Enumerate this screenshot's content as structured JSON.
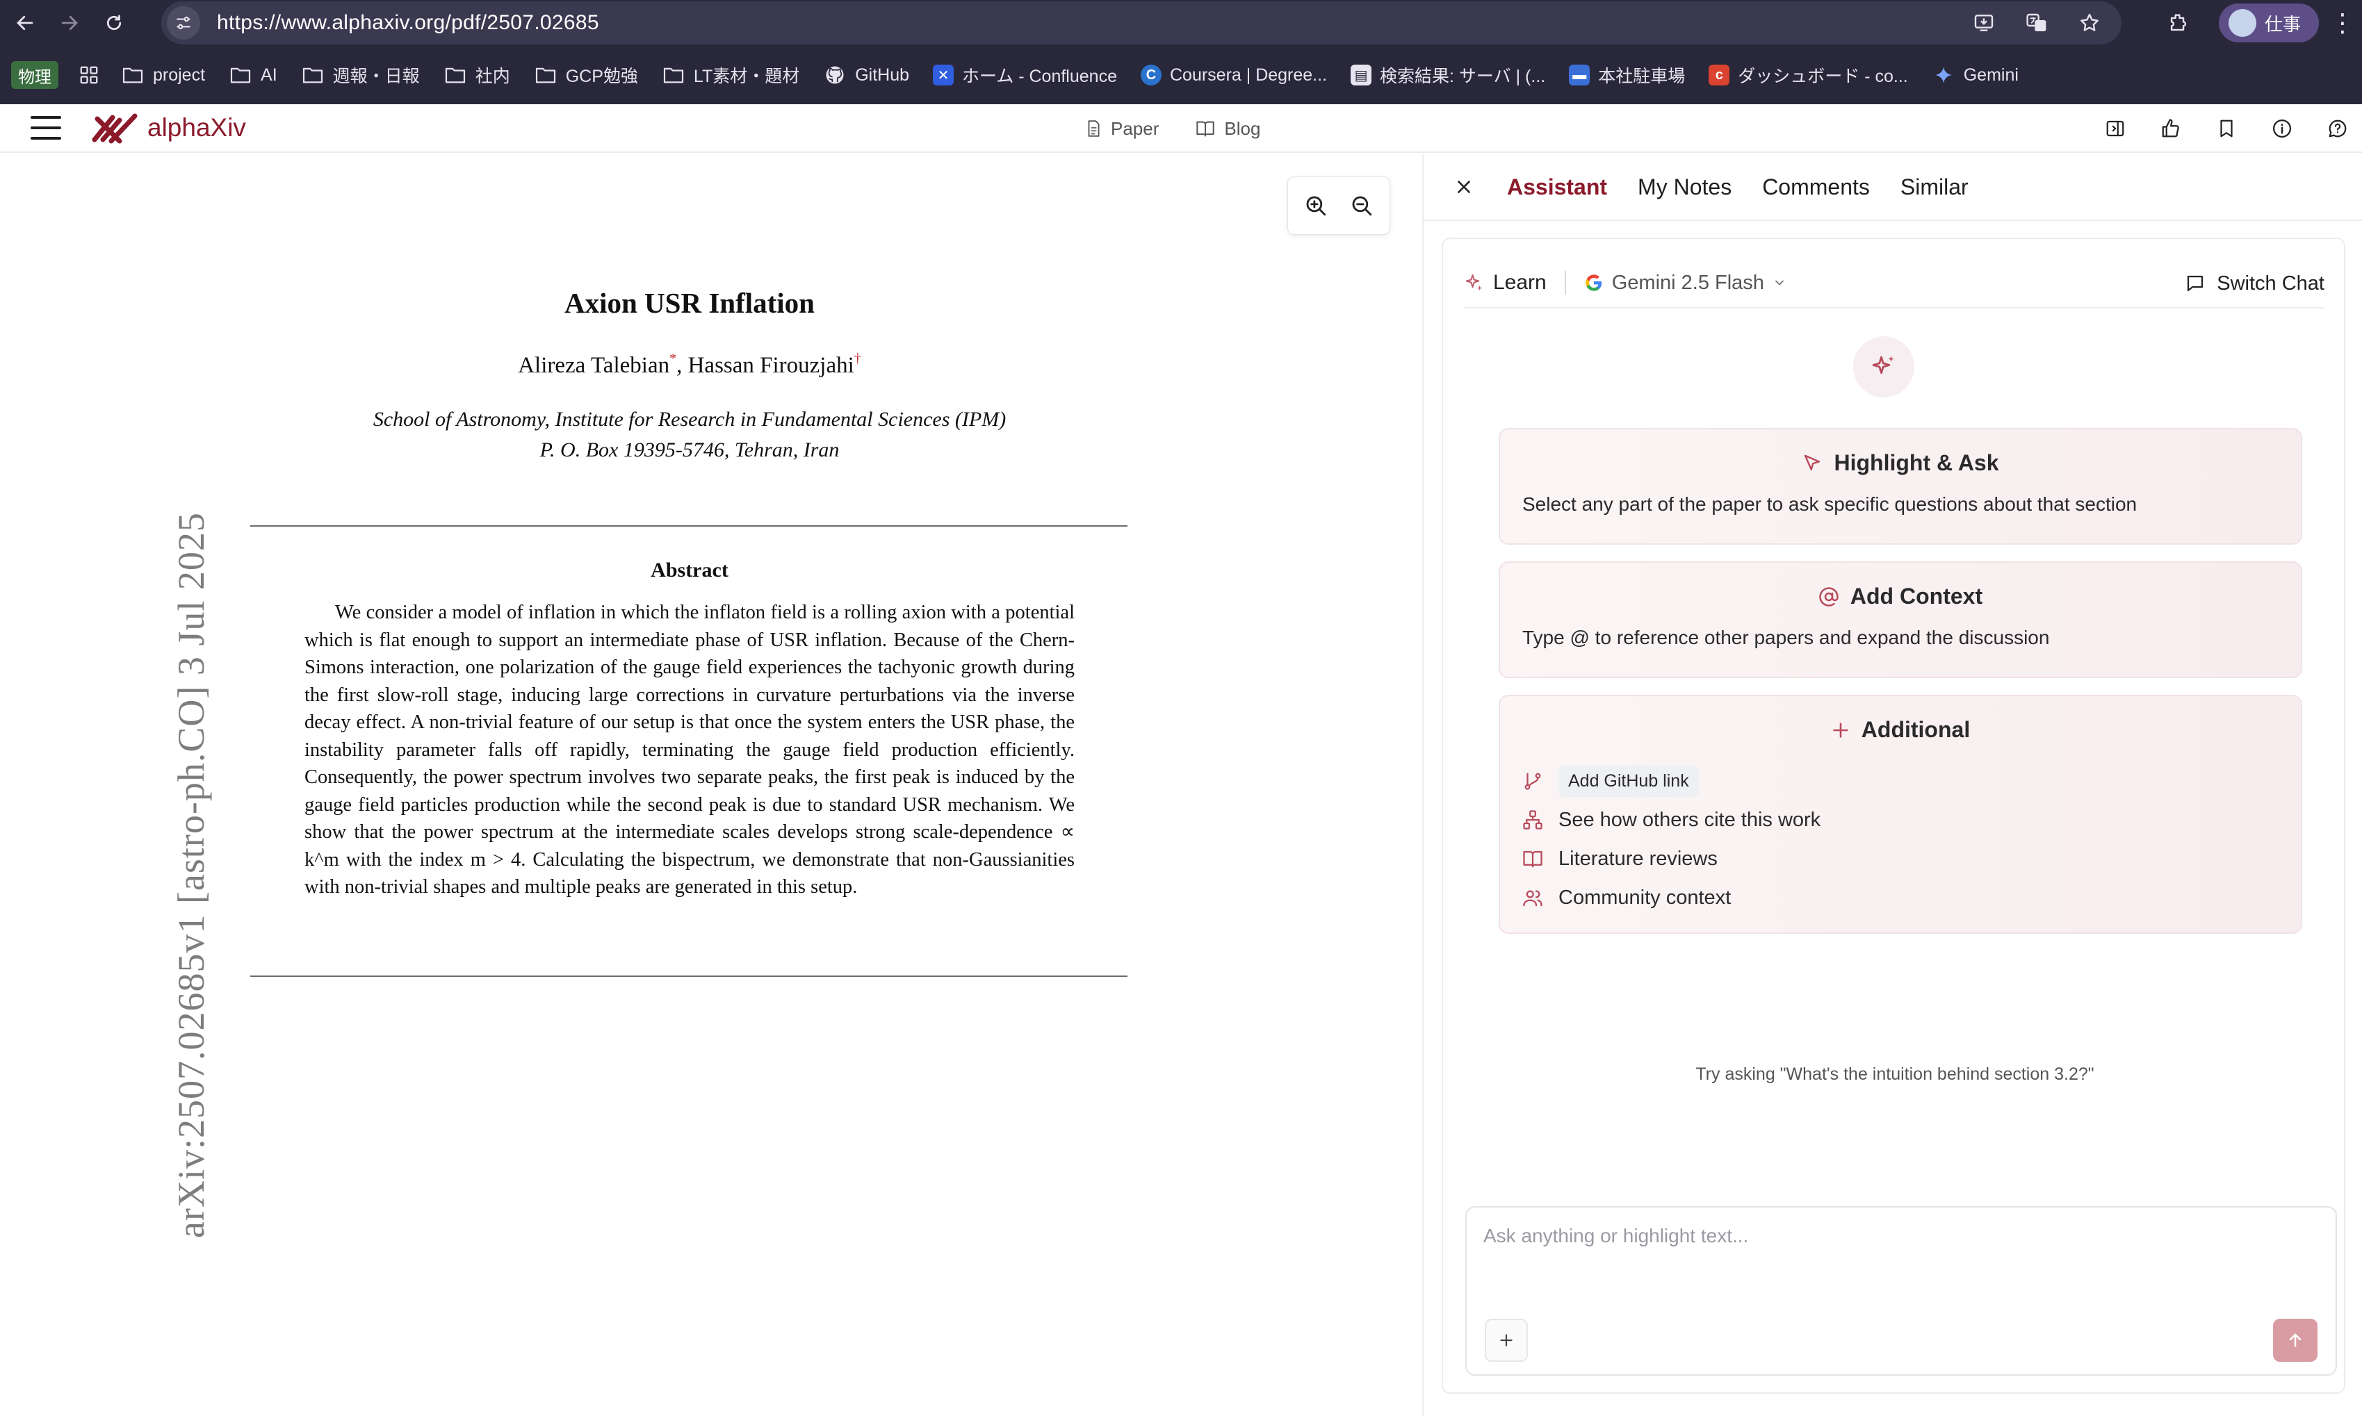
{
  "browser": {
    "url": "https://www.alphaxiv.org/pdf/2507.02685",
    "profile_label": "仕事",
    "bookmarks_first": "物理",
    "bookmarks": [
      {
        "label": "project",
        "icon": "folder-icon"
      },
      {
        "label": "AI",
        "icon": "folder-icon"
      },
      {
        "label": "週報・日報",
        "icon": "folder-icon"
      },
      {
        "label": "社内",
        "icon": "folder-icon"
      },
      {
        "label": "GCP勉強",
        "icon": "folder-icon"
      },
      {
        "label": "LT素材・題材",
        "icon": "folder-icon"
      },
      {
        "label": "GitHub",
        "icon": "github-icon"
      },
      {
        "label": "ホーム - Confluence",
        "icon": "confluence-icon"
      },
      {
        "label": "Coursera | Degree...",
        "icon": "coursera-icon"
      },
      {
        "label": "検索結果: サーバ | (...",
        "icon": "doc-icon"
      },
      {
        "label": "本社駐車場",
        "icon": "calendar-icon"
      },
      {
        "label": "ダッシュボード - co...",
        "icon": "c-icon"
      },
      {
        "label": "Gemini",
        "icon": "gemini-icon"
      }
    ]
  },
  "app": {
    "logo_text": "alphaXiv",
    "nav": {
      "paper": "Paper",
      "blog": "Blog"
    }
  },
  "paper": {
    "title": "Axion USR Inflation",
    "author1": "Alireza Talebian",
    "author1_mark": "*",
    "author2": "Hassan Firouzjahi",
    "author2_mark": "†",
    "affiliation_line1": "School of Astronomy, Institute for Research in Fundamental Sciences (IPM)",
    "affiliation_line2": "P. O. Box 19395-5746, Tehran, Iran",
    "abstract_heading": "Abstract",
    "abstract_text": "We consider a model of inflation in which the inflaton field is a rolling axion with a potential which is flat enough to support an intermediate phase of USR inflation. Because of the Chern-Simons interaction, one polarization of the gauge field experiences the tachyonic growth during the first slow-roll stage, inducing large corrections in curvature perturbations via the inverse decay effect. A non-trivial feature of our setup is that once the system enters the USR phase, the instability parameter falls off rapidly, terminating the gauge field production efficiently. Consequently, the power spectrum involves two separate peaks, the first peak is induced by the gauge field particles production while the second peak is due to standard USR mechanism. We show that the power spectrum at the intermediate scales develops strong scale-dependence ∝ k^m with the index m > 4. Calculating the bispectrum, we demonstrate that non-Gaussianities with non-trivial shapes and multiple peaks are generated in this setup.",
    "arxiv_stamp": "arXiv:2507.02685v1  [astro-ph.CO]  3 Jul 2025"
  },
  "panel": {
    "tabs": [
      "Assistant",
      "My Notes",
      "Comments",
      "Similar"
    ],
    "active_tab": "Assistant",
    "mode_label": "Learn",
    "model_label": "Gemini 2.5 Flash",
    "switch_chat": "Switch Chat",
    "highlight": {
      "title": "Highlight & Ask",
      "desc": "Select any part of the paper to ask specific questions about that section"
    },
    "context": {
      "title": "Add Context",
      "desc": "Type @ to reference other papers and expand the discussion"
    },
    "additional": {
      "title": "Additional",
      "github": "Add GitHub link",
      "cite": "See how others cite this work",
      "reviews": "Literature reviews",
      "community": "Community context"
    },
    "hint": "Try asking \"What's the intuition behind section 3.2?\"",
    "input_placeholder": "Ask anything or highlight text..."
  },
  "colors": {
    "brand": "#8b1a2b",
    "chrome_bg": "#29273a",
    "send_button": "#d99ca2"
  }
}
